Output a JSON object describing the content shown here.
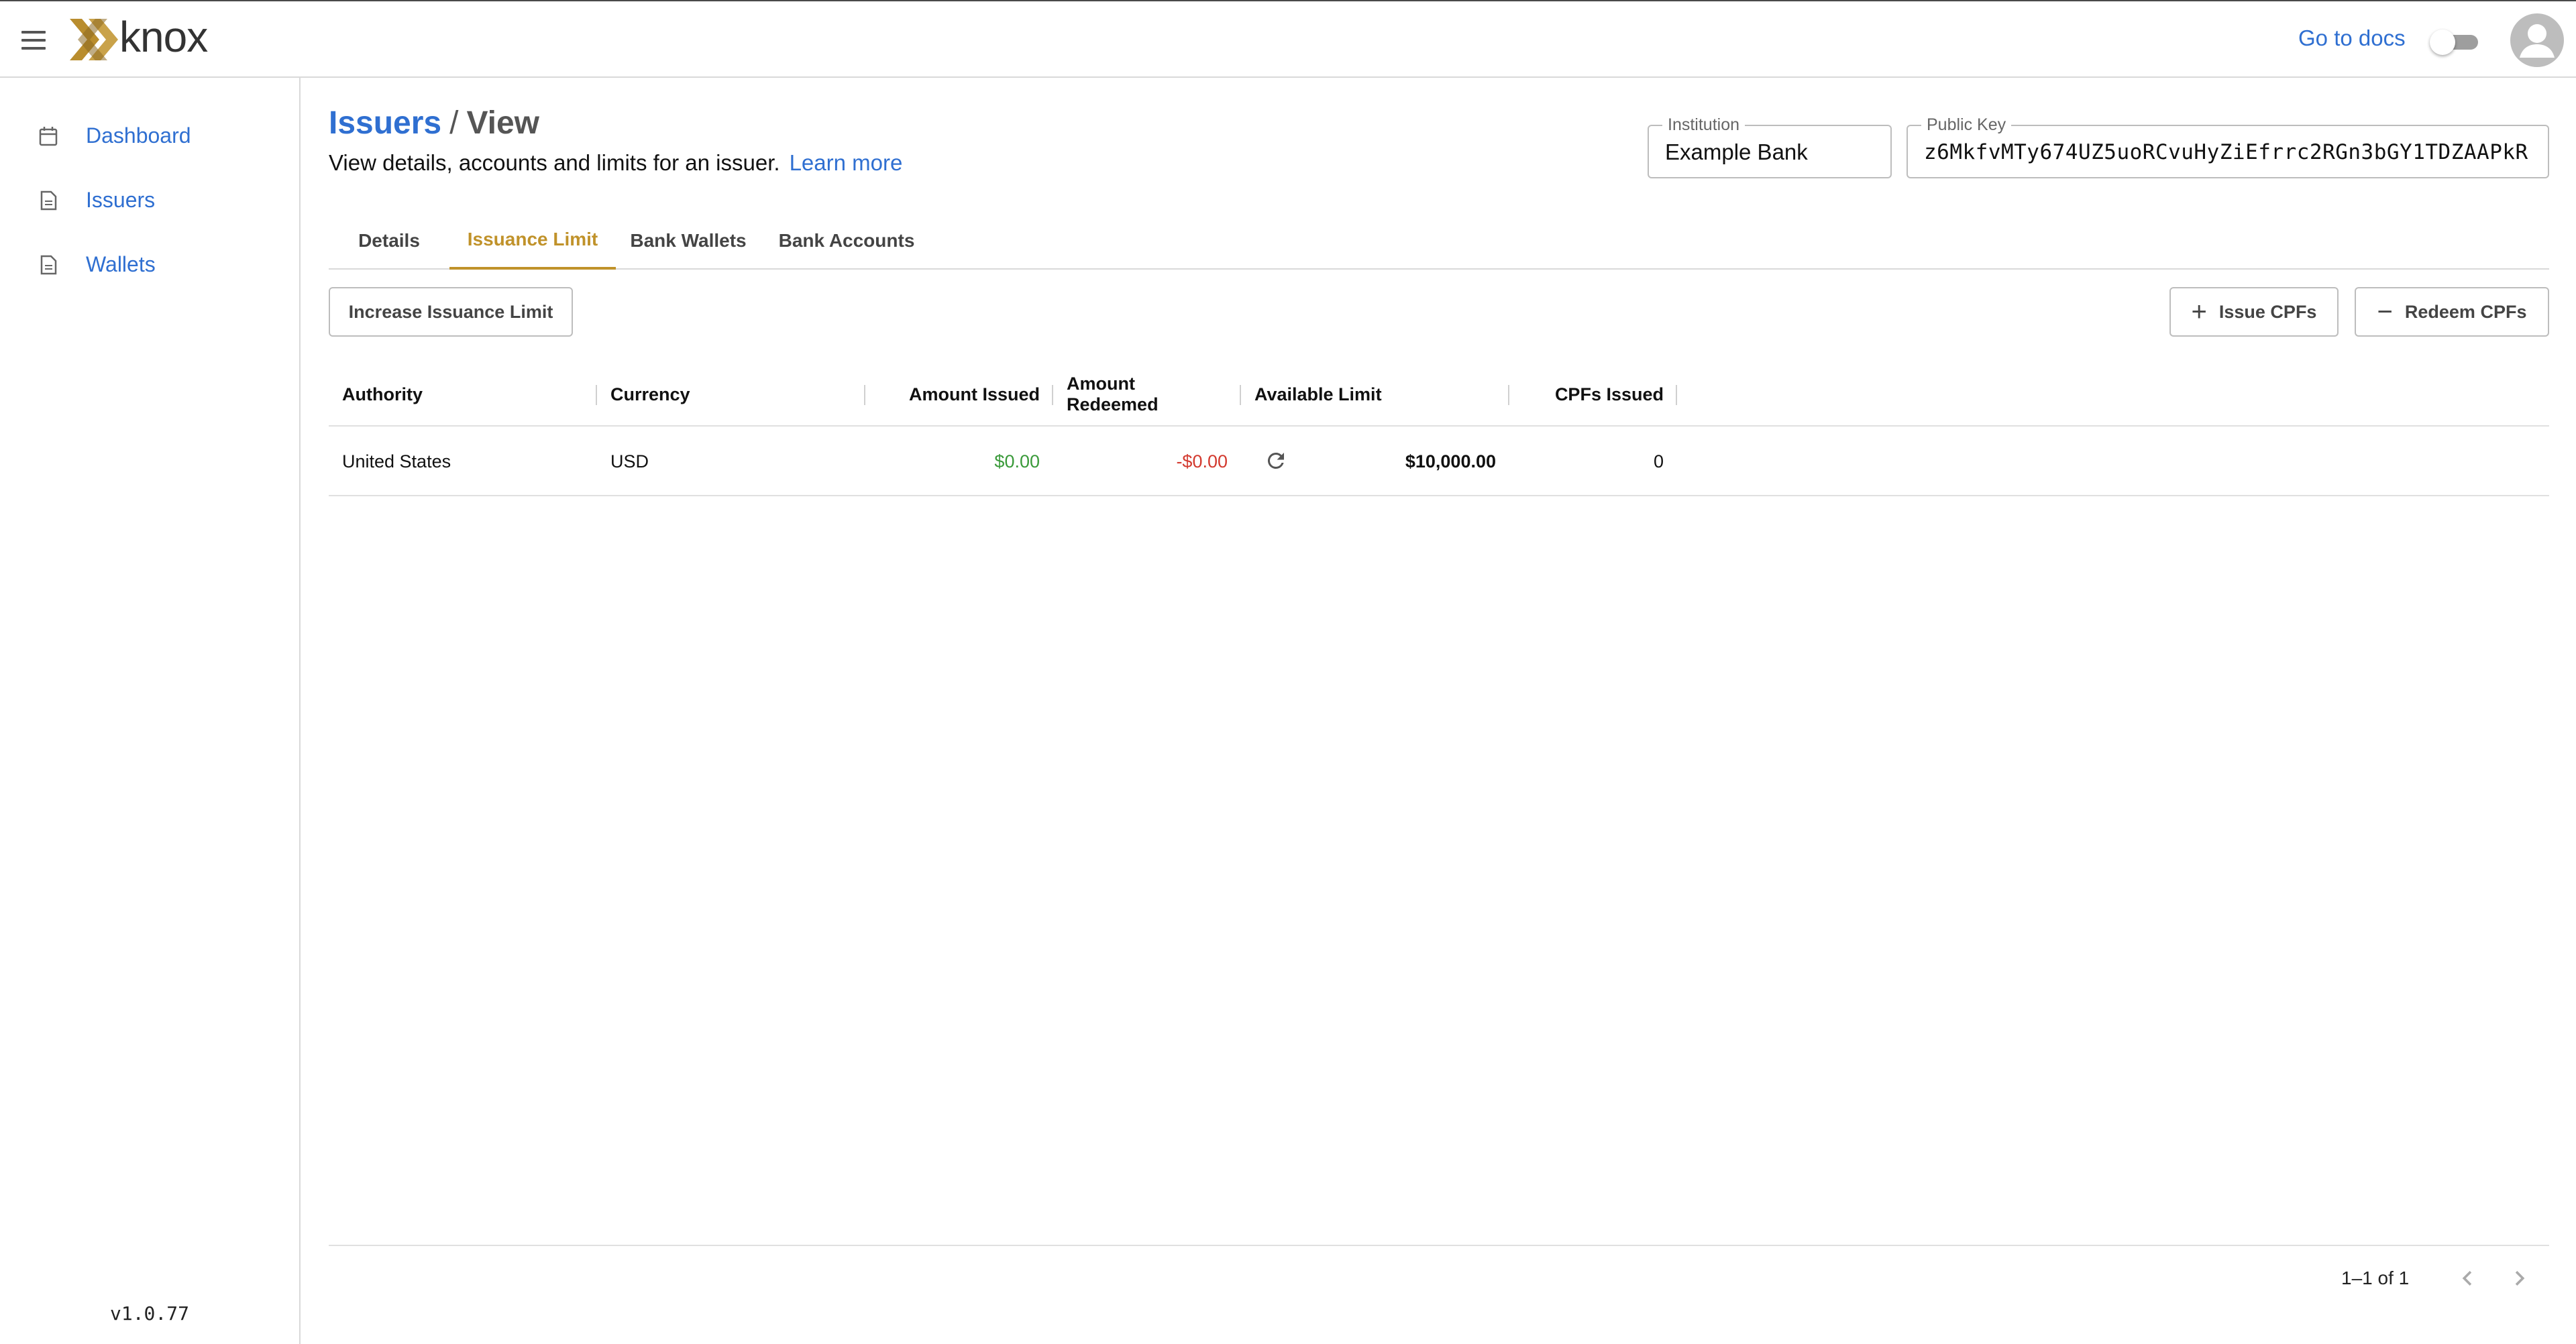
{
  "app": {
    "brand": "knox",
    "docs_link": "Go to docs",
    "version": "v1.0.77"
  },
  "sidebar": {
    "items": [
      {
        "label": "Dashboard",
        "icon": "calendar-icon"
      },
      {
        "label": "Issuers",
        "icon": "document-icon"
      },
      {
        "label": "Wallets",
        "icon": "document-icon"
      }
    ]
  },
  "header": {
    "breadcrumb_parent": "Issuers",
    "breadcrumb_separator": "/",
    "breadcrumb_current": "View",
    "subtitle": "View details, accounts and limits for an issuer.",
    "learn_more": "Learn more",
    "institution": {
      "label": "Institution",
      "value": "Example Bank"
    },
    "public_key": {
      "label": "Public Key",
      "value": "z6MkfvMTy674UZ5uoRCvuHyZiEfrrc2RGn3bGY1TDZAAPkR"
    }
  },
  "tabs": [
    {
      "label": "Details",
      "active": false
    },
    {
      "label": "Issuance Limit",
      "active": true
    },
    {
      "label": "Bank Wallets",
      "active": false
    },
    {
      "label": "Bank Accounts",
      "active": false
    }
  ],
  "actions": {
    "increase_limit": "Increase Issuance Limit",
    "issue": "Issue CPFs",
    "redeem": "Redeem CPFs"
  },
  "table": {
    "columns": [
      "Authority",
      "Currency",
      "Amount Issued",
      "Amount Redeemed",
      "Available Limit",
      "CPFs Issued"
    ],
    "rows": [
      {
        "authority": "United States",
        "currency": "USD",
        "amount_issued": "$0.00",
        "amount_redeemed": "-$0.00",
        "available_limit": "$10,000.00",
        "cpfs_issued": "0"
      }
    ]
  },
  "pagination": {
    "info": "1–1 of 1"
  },
  "colors": {
    "accent": "#c0922a",
    "link": "#2f6fd1",
    "positive": "#3a9a3a",
    "negative": "#d33a2f"
  }
}
